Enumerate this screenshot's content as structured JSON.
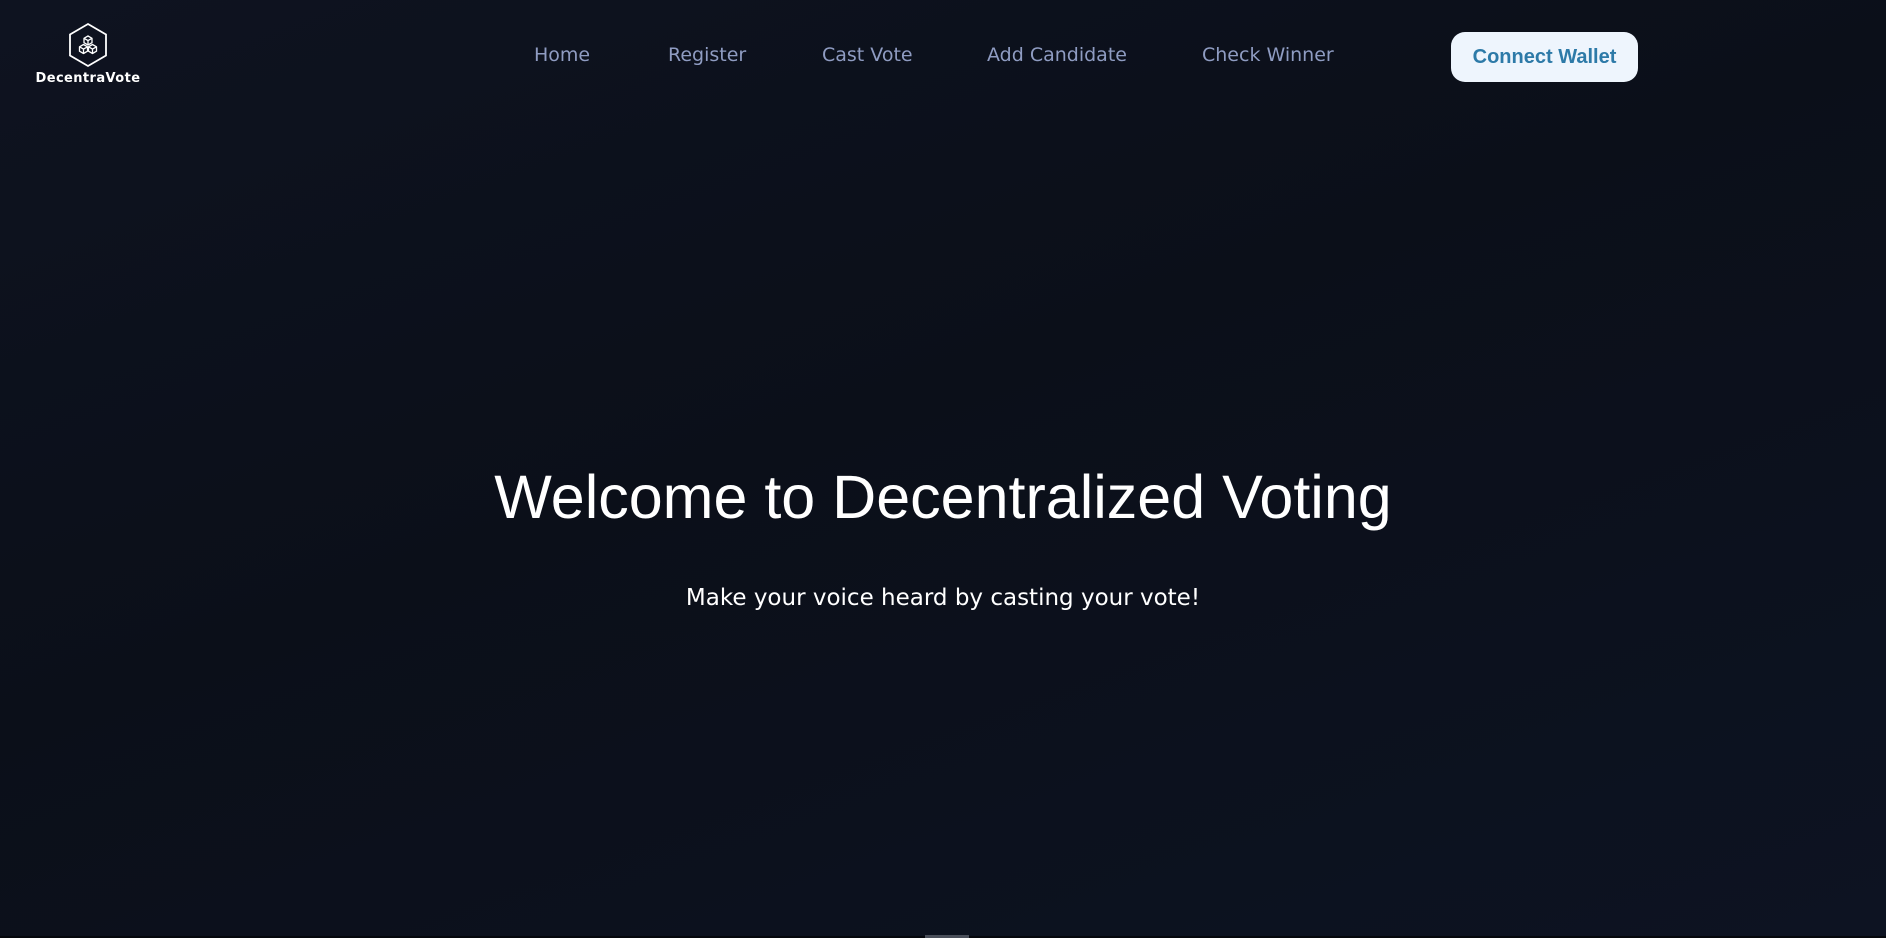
{
  "brand": {
    "name": "DecentraVote",
    "icon": "hexagon-cubes-icon"
  },
  "nav": {
    "items": [
      {
        "label": "Home"
      },
      {
        "label": "Register"
      },
      {
        "label": "Cast Vote"
      },
      {
        "label": "Add Candidate"
      },
      {
        "label": "Check Winner"
      }
    ],
    "connect_label": "Connect Wallet"
  },
  "hero": {
    "title": "Welcome to Decentralized Voting",
    "subtitle": "Make your voice heard by casting your vote!"
  },
  "colors": {
    "background": "#0b0f19",
    "nav_text": "#8f9cc2",
    "button_bg": "#eef5fd",
    "button_text": "#2d7aa8",
    "hero_text": "#ffffff"
  }
}
